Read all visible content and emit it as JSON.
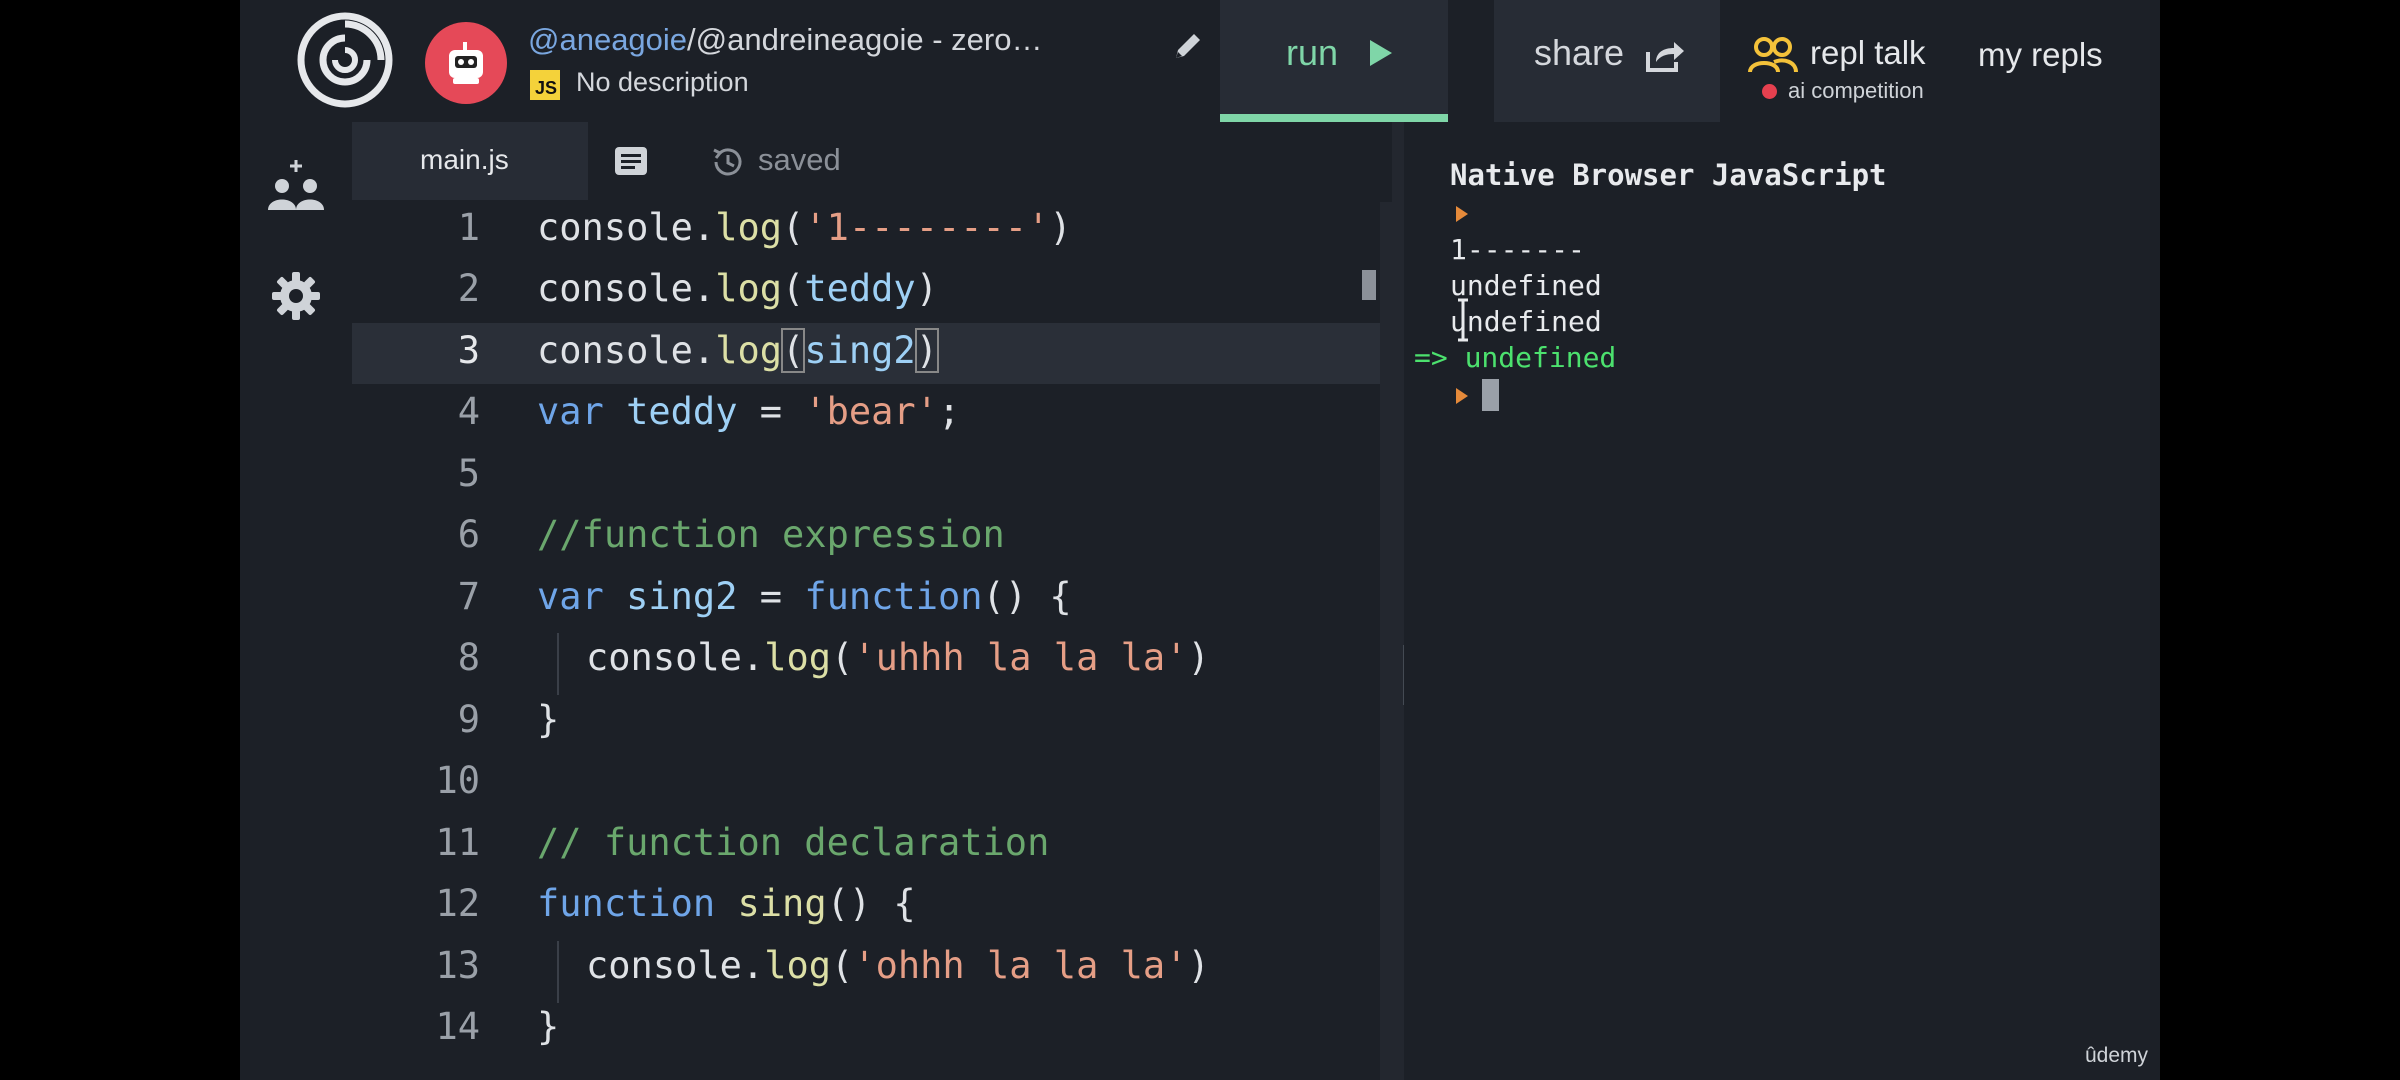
{
  "header": {
    "user_link": "@aneagoie",
    "repl_path": "/@andreineagoie - zero…",
    "language_badge": "JS",
    "description": "No description",
    "run_label": "run",
    "share_label": "share",
    "repl_talk_label": "repl talk",
    "ai_competition_label": "ai competition",
    "my_repls_label": "my repls",
    "accent_color": "#7fd6a8"
  },
  "editor": {
    "tab_label": "main.js",
    "status": "saved",
    "current_line": 3,
    "lines": [
      {
        "num": "1"
      },
      {
        "num": "2"
      },
      {
        "num": "3"
      },
      {
        "num": "4"
      },
      {
        "num": "5"
      },
      {
        "num": "6"
      },
      {
        "num": "7"
      },
      {
        "num": "8"
      },
      {
        "num": "9"
      },
      {
        "num": "10"
      },
      {
        "num": "11"
      },
      {
        "num": "12"
      },
      {
        "num": "13"
      },
      {
        "num": "14"
      }
    ],
    "code": {
      "l1": "console.log('1--------')",
      "l2": "console.log(teddy)",
      "l3": "console.log(sing2)",
      "l4": "var teddy = 'bear';",
      "l6": "//function expression",
      "l7": "var sing2 = function() {",
      "l8": "console.log('uhhh la la la')",
      "l9": "}",
      "l11": "// function declaration",
      "l12": "function sing() {",
      "l13": "console.log('ohhh la la la')",
      "l14": "}"
    }
  },
  "console": {
    "title": "Native Browser JavaScript",
    "output": [
      "1-------",
      "undefined",
      "undefined"
    ],
    "result": "=> undefined"
  },
  "watermark": "ûdemy"
}
